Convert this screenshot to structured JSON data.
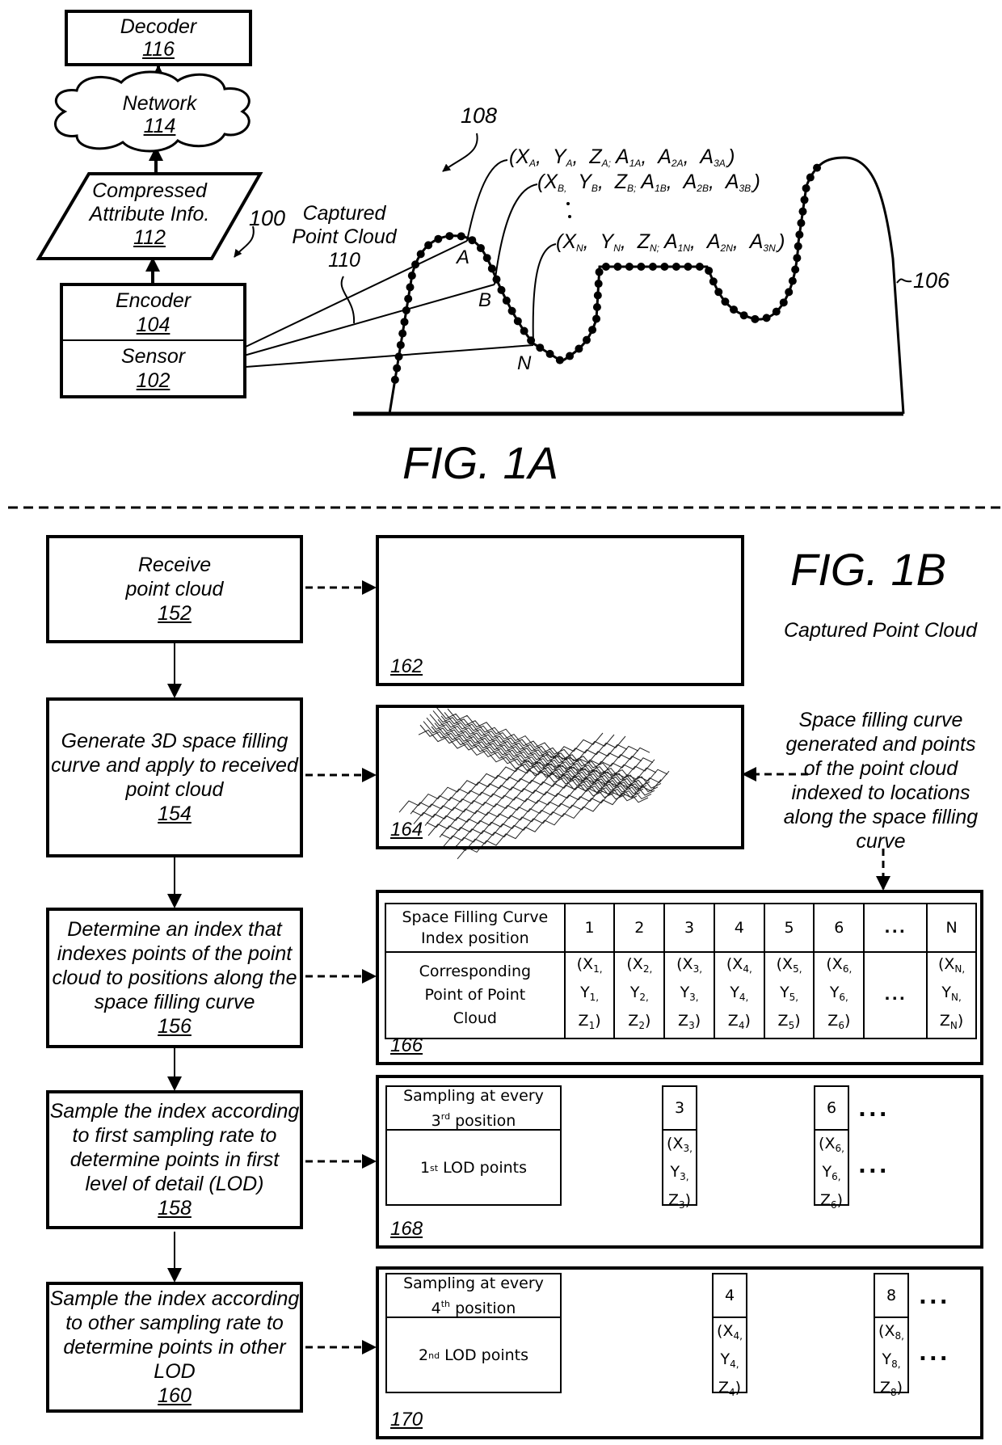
{
  "fig1a": {
    "title": "FIG. 1A",
    "decoder": {
      "label": "Decoder",
      "ref": "116"
    },
    "network": {
      "label": "Network",
      "ref": "114"
    },
    "compressed": {
      "line1": "Compressed",
      "line2": "Attribute Info.",
      "ref": "112"
    },
    "encoder": {
      "label": "Encoder",
      "ref": "104"
    },
    "sensor": {
      "label": "Sensor",
      "ref": "102"
    },
    "system_ref": "100",
    "captured_label": {
      "line1": "Captured",
      "line2": "Point Cloud",
      "ref": "110"
    },
    "scene_ref": "108",
    "object_ref": "106",
    "point_labels": [
      "A",
      "B",
      "N"
    ],
    "point_tuples": [
      {
        "id": "A",
        "text": "(XA, YA, ZA; A1A, A2A, A3A,)"
      },
      {
        "id": "B",
        "text": "(XB, YB, ZB; A1B, A2B, A3B,)"
      },
      {
        "id": "N",
        "text": "(XN, YN, ZN; A1N, A2N, A3N,)"
      }
    ]
  },
  "fig1b": {
    "title": "FIG. 1B",
    "subtitle": "Captured Point Cloud",
    "steps": [
      {
        "text": [
          "Receive",
          "point cloud"
        ],
        "ref": "152"
      },
      {
        "text": [
          "Generate 3D space filling",
          "curve and apply to received",
          "point cloud"
        ],
        "ref": "154"
      },
      {
        "text": [
          "Determine an index that",
          "indexes points of the point",
          "cloud to positions along the",
          "space filling curve"
        ],
        "ref": "156"
      },
      {
        "text": [
          "Sample the index according",
          "to first sampling rate to",
          "determine points in first",
          "level of detail (LOD)"
        ],
        "ref": "158"
      },
      {
        "text": [
          "Sample the index according",
          "to other sampling rate to",
          "determine points in other",
          "LOD"
        ],
        "ref": "160"
      }
    ],
    "panels": {
      "p162": {
        "ref": "162"
      },
      "p164": {
        "ref": "164"
      },
      "p166": {
        "ref": "166"
      },
      "p168": {
        "ref": "168"
      },
      "p170": {
        "ref": "170"
      }
    },
    "annotation": [
      "Space filling curve",
      "generated and points",
      "of the point cloud",
      "indexed to locations",
      "along the space filling",
      "curve"
    ],
    "index_table": {
      "row1_header": [
        "Space Filling Curve",
        "Index position"
      ],
      "row2_header": [
        "Corresponding",
        "Point of Point",
        "Cloud"
      ],
      "positions": [
        "1",
        "2",
        "3",
        "4",
        "5",
        "6",
        "...",
        "N"
      ],
      "points": [
        {
          "x": "X",
          "y": "Y",
          "z": "Z",
          "s": "1"
        },
        {
          "x": "X",
          "y": "Y",
          "z": "Z",
          "s": "2"
        },
        {
          "x": "X",
          "y": "Y",
          "z": "Z",
          "s": "3"
        },
        {
          "x": "X",
          "y": "Y",
          "z": "Z",
          "s": "4"
        },
        {
          "x": "X",
          "y": "Y",
          "z": "Z",
          "s": "5"
        },
        {
          "x": "X",
          "y": "Y",
          "z": "Z",
          "s": "6"
        },
        null,
        {
          "x": "X",
          "y": "Y",
          "z": "Z",
          "s": "N"
        }
      ]
    },
    "lod1": {
      "header_pre": "Sampling at every",
      "header_num": "3",
      "header_sup": "rd",
      "header_post": "position",
      "points_num": "1",
      "points_sup": "st",
      "points_post": "LOD points",
      "samples": [
        "3",
        "6"
      ],
      "ellipsis": "..."
    },
    "lod2": {
      "header_pre": "Sampling at every",
      "header_num": "4",
      "header_sup": "th",
      "header_post": "position",
      "points_num": "2",
      "points_sup": "nd",
      "points_post": "LOD points",
      "samples": [
        "4",
        "8"
      ],
      "ellipsis": "..."
    }
  }
}
